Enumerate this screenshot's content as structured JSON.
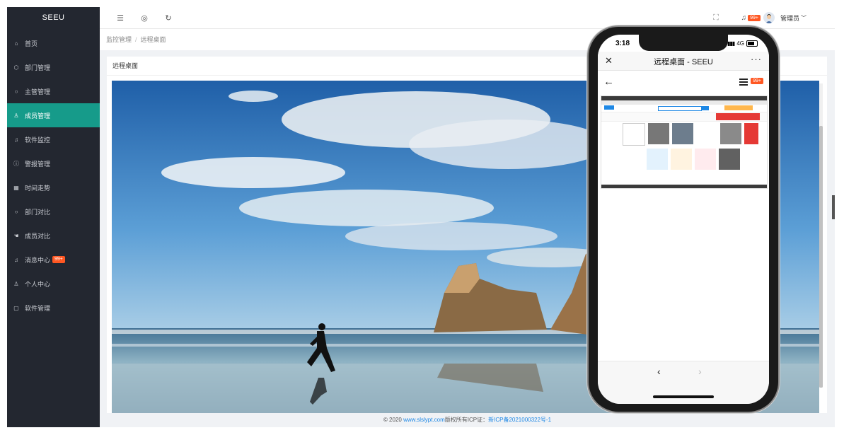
{
  "app": {
    "logo": "SEEU"
  },
  "sidebar": {
    "items": [
      {
        "label": "首页",
        "icon": "home-icon",
        "glyph": "⌂"
      },
      {
        "label": "部门管理",
        "icon": "cube-icon",
        "glyph": "⬡"
      },
      {
        "label": "主管管理",
        "icon": "circle-icon",
        "glyph": "○"
      },
      {
        "label": "成员管理",
        "icon": "user-icon",
        "glyph": "♙"
      },
      {
        "label": "软件监控",
        "icon": "bell-icon",
        "glyph": "♫"
      },
      {
        "label": "警报管理",
        "icon": "info-icon",
        "glyph": "ⓘ"
      },
      {
        "label": "时间走势",
        "icon": "grid-icon",
        "glyph": "▦"
      },
      {
        "label": "部门对比",
        "icon": "circle-icon",
        "glyph": "○"
      },
      {
        "label": "成员对比",
        "icon": "hand-icon",
        "glyph": "☚"
      },
      {
        "label": "消息中心",
        "icon": "bell-icon",
        "glyph": "♫",
        "badge": "99+"
      },
      {
        "label": "个人中心",
        "icon": "person-icon",
        "glyph": "♙"
      },
      {
        "label": "软件管理",
        "icon": "file-icon",
        "glyph": "▢"
      }
    ],
    "active_index": 3
  },
  "header": {
    "notify_badge": "99+",
    "username": "管理员",
    "dropdown_glyph": "﹀"
  },
  "breadcrumb": {
    "parent": "监控管理",
    "separator": "/",
    "current": "远程桌面"
  },
  "card": {
    "title": "远程桌面"
  },
  "footer": {
    "prefix": "© 2020 ",
    "site": "www.slslypt.com",
    "middle": "版权所有ICP证：",
    "icp": "新ICP备2021000322号-1"
  },
  "phone": {
    "time": "3:18",
    "network": "4G",
    "title": "远程桌面 - SEEU",
    "badge": "99+",
    "more": "···",
    "close": "✕",
    "back": "←",
    "prev": "‹",
    "next": "›"
  },
  "colors": {
    "sidebar_bg": "#232730",
    "active": "#169b8a",
    "badge": "#ff5722",
    "link": "#1e88e5"
  }
}
